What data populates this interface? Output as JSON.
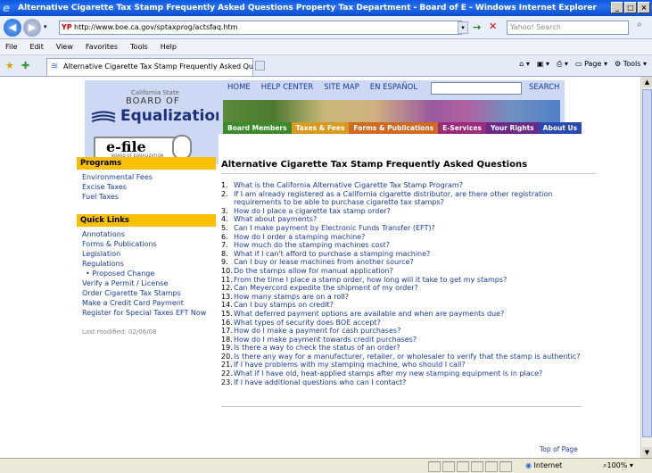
{
  "window": {
    "title": "Alternative Cigarette Tax Stamp Frequently Asked Questions Property Tax Department - Board of E - Windows Internet Explorer"
  },
  "addressbar": {
    "url": "http://www.boe.ca.gov/sptaxprog/actsfaq.htm",
    "search_placeholder": "Yahoo! Search"
  },
  "menu": [
    "File",
    "Edit",
    "View",
    "Favorites",
    "Tools",
    "Help"
  ],
  "tab": {
    "label": "Alternative Cigarette Tax Stamp Frequently Asked Qu..."
  },
  "toolbar": {
    "page_label": "Page",
    "tools_label": "Tools"
  },
  "site": {
    "logo_small": "California State",
    "logo_board": "BOARD OF",
    "logo_main": "Equalization",
    "efile": "e-file",
    "efile_sub": "BOARD OF EQUALIZATION",
    "topnav": [
      "HOME",
      "HELP CENTER",
      "SITE MAP",
      "EN ESPAÑOL"
    ],
    "search_label": "SEARCH",
    "main_tabs": [
      {
        "label": "Board Members",
        "color": "#3d8a2a"
      },
      {
        "label": "Taxes & Fees",
        "color": "#d89a20"
      },
      {
        "label": "Forms & Publications",
        "color": "#d06a20"
      },
      {
        "label": "E-Services",
        "color": "#9a2a7a"
      },
      {
        "label": "Your Rights",
        "color": "#6a2a8a"
      },
      {
        "label": "About Us",
        "color": "#2a4ab0"
      }
    ]
  },
  "sidebar": {
    "programs_head": "Programs",
    "programs": [
      "Environmental Fees",
      "Excise Taxes",
      "Fuel Taxes"
    ],
    "quicklinks_head": "Quick Links",
    "quicklinks": [
      "Annotations",
      "Forms & Publications",
      "Legislation",
      "Regulations"
    ],
    "bullet_item": "Proposed Change",
    "more_links": [
      "Verify a Permit / License",
      "Order Cigarette Tax Stamps",
      "Make a Credit Card Payment",
      "Register for Special Taxes EFT Now"
    ],
    "last_modified": "Last modified: 02/06/08"
  },
  "main": {
    "title": "Alternative Cigarette Tax Stamp Frequently Asked Questions",
    "faqs": [
      "What is the California Alternative Cigarette Tax Stamp Program?",
      "If I am already registered as a California cigarette distributor, are there other registration requirements to be able to purchase cigarette tax stamps?",
      "How do I place a cigarette tax stamp order?",
      "What about payments?",
      "Can I make payment by Electronic Funds Transfer (EFT)?",
      "How do I order a stamping machine?",
      "How much do the stamping machines cost?",
      "What if I can't afford to purchase a stamping machine?",
      "Can I buy or lease machines from another source?",
      "Do the stamps allow for manual application?",
      "From the time I place a stamp order, how long will it take to get my stamps?",
      "Can Meyercord expedite the shipment of my order?",
      "How many stamps are on a roll?",
      "Can I buy stamps on credit?",
      "What deferred payment options are available and when are payments due?",
      "What types of security does BOE accept?",
      "How do I make a payment for cash purchases?",
      "How do I make payment towards credit purchases?",
      "Is there a way to check the status of an order?",
      "Is there any way for a manufacturer, retailer, or wholesaler to verify that the stamp is authentic?",
      "If I have problems with my stamping machine, who should I call?",
      "What if I have old, heat-applied stamps after my new stamping equipment is in place?",
      "If I have additional questions who can I contact?"
    ],
    "top_link": "Top of Page"
  },
  "status": {
    "zone": "Internet",
    "zoom": "100%"
  }
}
